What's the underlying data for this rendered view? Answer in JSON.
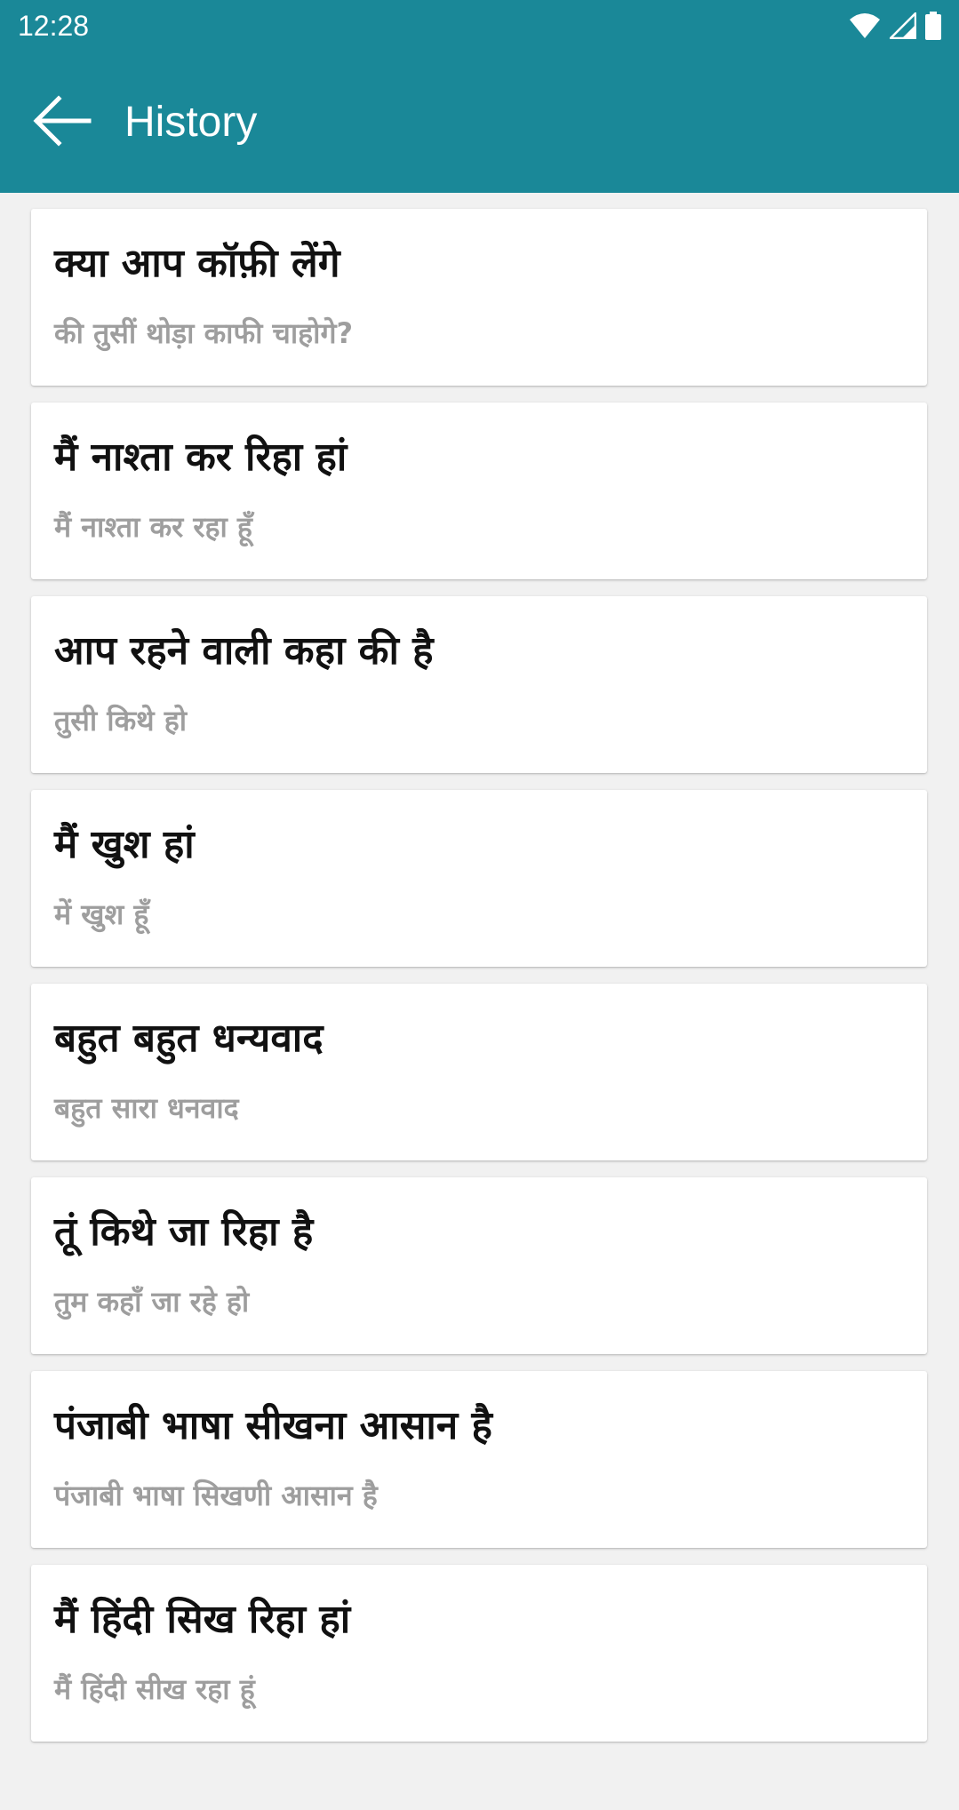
{
  "status_bar": {
    "time": "12:28",
    "icons": [
      "wifi-icon",
      "cell-signal-icon",
      "battery-icon"
    ]
  },
  "app_bar": {
    "back_icon": "arrow-left-icon",
    "title": "History"
  },
  "colors": {
    "primary": "#1a8898",
    "background": "#f1f1f1",
    "card": "#ffffff",
    "primary_text": "#111111",
    "secondary_text": "#9e9e9e"
  },
  "history": [
    {
      "source": "क्या आप कॉफ़ी लेंगे",
      "translation": "की तुसीं थोड़ा काफी चाहोगे?"
    },
    {
      "source": "मैं नाश्ता कर रिहा हां",
      "translation": "मैं नाश्ता कर रहा हूँ"
    },
    {
      "source": "आप रहने वाली कहा की है",
      "translation": "तुसी किथे हो"
    },
    {
      "source": "मैं खुश हां",
      "translation": "में खुश हूँ"
    },
    {
      "source": "बहुत बहुत धन्यवाद",
      "translation": "बहुत सारा धनवाद"
    },
    {
      "source": "तूं किथे जा रिहा है",
      "translation": "तुम कहाँ जा रहे हो"
    },
    {
      "source": "पंजाबी भाषा सीखना आसान है",
      "translation": "पंजाबी भाषा सिखणी आसान है"
    },
    {
      "source": "मैं हिंदी सिख रिहा हां",
      "translation": "मैं हिंदी सीख रहा हूं"
    }
  ]
}
